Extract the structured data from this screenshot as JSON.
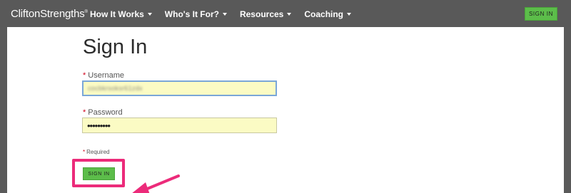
{
  "header": {
    "logo": "CliftonStrengths",
    "logo_mark": "®",
    "nav": [
      {
        "label": "How It Works"
      },
      {
        "label": "Who's It For?"
      },
      {
        "label": "Resources"
      },
      {
        "label": "Coaching"
      }
    ],
    "sign_in_label": "SIGN IN"
  },
  "form": {
    "title": "Sign In",
    "required_marker": "*",
    "username_label": "Username",
    "username_value": "cocbkrsoksr61zdx",
    "password_label": "Password",
    "password_value": "•••••••••",
    "required_note": "Required",
    "submit_label": "SIGN IN"
  },
  "annotation": {
    "highlight_color": "#ec2b7a"
  },
  "colors": {
    "header_bg": "#595959",
    "button_green": "#5cbd4a",
    "field_bg": "#fbfbc4",
    "focus_border": "#7aa7d8"
  }
}
